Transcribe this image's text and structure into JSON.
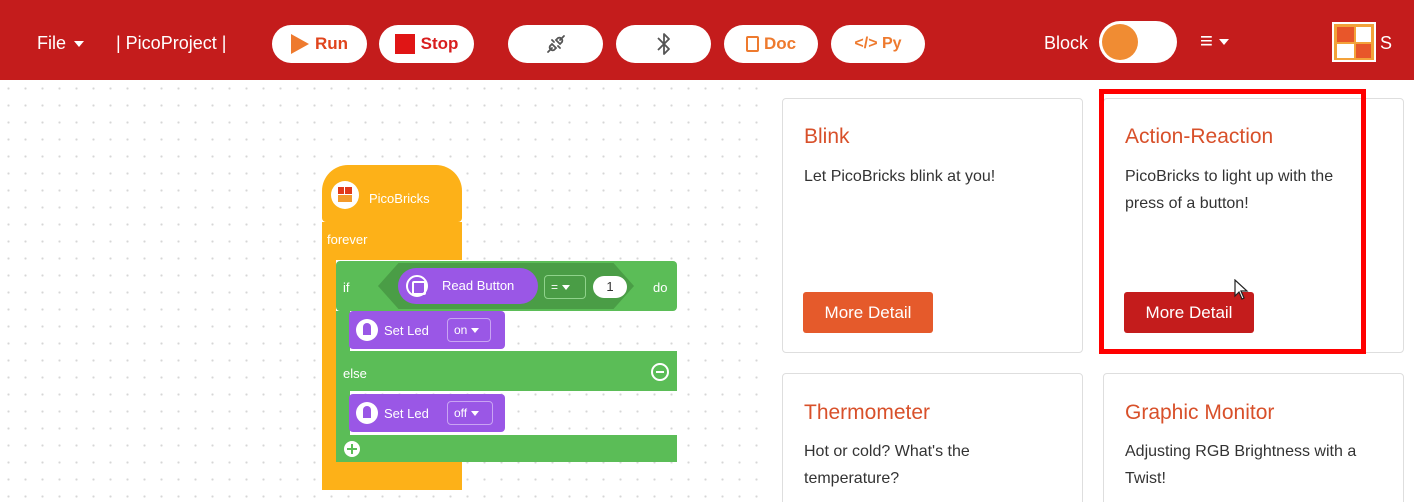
{
  "toolbar": {
    "file_label": "File",
    "project_name": "| PicoProject |",
    "run_label": "Run",
    "stop_label": "Stop",
    "doc_label": "Doc",
    "py_label": "</> Py",
    "block_label": "Block",
    "menu_icon_label": "≡",
    "right_truncated": "S"
  },
  "blocks": {
    "hat_label": "PicoBricks",
    "forever_label": "forever",
    "if_label": "if",
    "do_label": "do",
    "read_button_label": "Read Button",
    "operator": "=",
    "compare_value": "1",
    "else_label": "else",
    "set_led_1_label": "Set Led",
    "set_led_1_value": "on",
    "set_led_2_label": "Set Led",
    "set_led_2_value": "off"
  },
  "cards": [
    {
      "title": "Blink",
      "desc": "Let PicoBricks blink at you!",
      "button": "More Detail"
    },
    {
      "title": "Action-Reaction",
      "desc": "PicoBricks to light up with the press of a button!",
      "button": "More Detail"
    },
    {
      "title": "Thermometer",
      "desc": "Hot or cold? What's the temperature?"
    },
    {
      "title": "Graphic Monitor",
      "desc": "Adjusting RGB Brightness with a Twist!"
    }
  ],
  "colors": {
    "topbar": "#c41c1c",
    "accent_orange": "#ee7a2e",
    "card_title": "#d8502a",
    "button_primary": "#e55a2b",
    "button_active": "#c41c1c",
    "highlight": "#ff0000"
  }
}
